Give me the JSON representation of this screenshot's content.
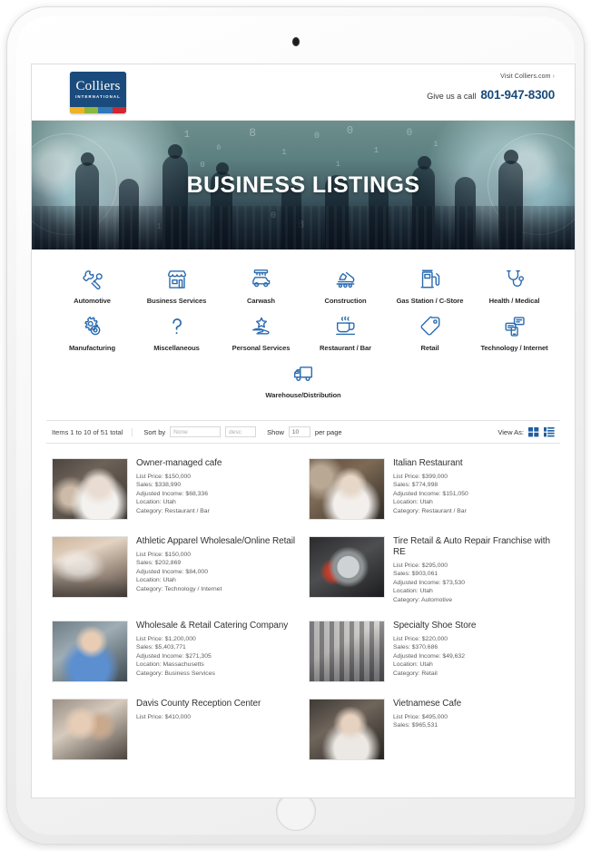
{
  "device": {
    "type": "tablet-white"
  },
  "header": {
    "logo": {
      "word": "Colliers",
      "sub": "INTERNATIONAL",
      "stripes": [
        "#f0b323",
        "#8cb63c",
        "#2e7ab8",
        "#d22630"
      ],
      "bg": "#1a4b7c"
    },
    "visit_link": "Visit Colliers.com",
    "visit_chevron": "›",
    "call_label": "Give us a call",
    "call_number": "801-947-8300",
    "accent": "#1a4b7c"
  },
  "hero": {
    "title": "BUSINESS LISTINGS"
  },
  "categories": {
    "rows": [
      [
        {
          "label": "Automotive",
          "icon": "wrench-screwdriver-icon"
        },
        {
          "label": "Business Services",
          "icon": "storefront-icon"
        },
        {
          "label": "Carwash",
          "icon": "carwash-icon"
        },
        {
          "label": "Construction",
          "icon": "excavator-icon"
        },
        {
          "label": "Gas Station / C-Store",
          "icon": "fuel-pump-icon"
        },
        {
          "label": "Health / Medical",
          "icon": "stethoscope-icon"
        }
      ],
      [
        {
          "label": "Manufacturing",
          "icon": "gears-icon"
        },
        {
          "label": "Miscellaneous",
          "icon": "question-mark-icon"
        },
        {
          "label": "Personal Services",
          "icon": "star-hand-icon"
        },
        {
          "label": "Restaurant / Bar",
          "icon": "coffee-cup-icon"
        },
        {
          "label": "Retail",
          "icon": "price-tag-icon"
        },
        {
          "label": "Technology / Internet",
          "icon": "devices-icon"
        }
      ],
      [
        {
          "label": "Warehouse/Distribution",
          "icon": "truck-icon"
        }
      ]
    ]
  },
  "toolbar": {
    "count_text": "Items 1 to 10 of 51 total",
    "sort_label": "Sort by",
    "sort_value": "None",
    "direction_value": "desc",
    "show_label": "Show",
    "show_value": "10",
    "per_page_label": "per page",
    "view_as_label": "View As:",
    "view_grid_icon": "grid-view-icon",
    "view_list_icon": "list-view-icon",
    "view_accent": "#1f5fa0"
  },
  "listings": {
    "labels": {
      "list_price": "List Price:",
      "sales": "Sales:",
      "adjusted_income": "Adjusted Income:",
      "location": "Location:",
      "category": "Category:"
    },
    "items": [
      {
        "title": "Owner-managed cafe",
        "list_price": "$150,000",
        "sales": "$338,990",
        "adjusted_income": "$68,336",
        "location": "Utah",
        "category": "Restaurant / Bar",
        "thumb": "man-in-cafe-photo"
      },
      {
        "title": "Italian Restaurant",
        "list_price": "$399,000",
        "sales": "$774,998",
        "adjusted_income": "$151,050",
        "location": "Utah",
        "category": "Restaurant / Bar",
        "thumb": "chef-in-restaurant-photo"
      },
      {
        "title": "Athletic Apparel Wholesale/Online Retail",
        "list_price": "$150,000",
        "sales": "$202,869",
        "adjusted_income": "$84,000",
        "location": "Utah",
        "category": "Technology / Internet",
        "thumb": "desk-laptop-photo"
      },
      {
        "title": "Tire Retail & Auto Repair Franchise with RE",
        "list_price": "$295,000",
        "sales": "$903,061",
        "adjusted_income": "$73,530",
        "location": "Utah",
        "category": "Automotive",
        "thumb": "brake-disc-photo"
      },
      {
        "title": "Wholesale & Retail Catering Company",
        "list_price": "$1,200,000",
        "sales": "$5,403,771",
        "adjusted_income": "$271,305",
        "location": "Massachusetts",
        "category": "Business Services",
        "thumb": "smiling-man-phone-photo"
      },
      {
        "title": "Specialty Shoe Store",
        "list_price": "$220,000",
        "sales": "$370,686",
        "adjusted_income": "$49,632",
        "location": "Utah",
        "category": "Retail",
        "thumb": "shoe-store-photo"
      },
      {
        "title": "Davis County Reception Center",
        "list_price": "$410,000",
        "sales": "",
        "adjusted_income": "",
        "location": "",
        "category": "",
        "thumb": "couple-photo"
      },
      {
        "title": "Vietnamese Cafe",
        "list_price": "$495,000",
        "sales": "$965,531",
        "adjusted_income": "",
        "location": "",
        "category": "",
        "thumb": "man-in-cafe-2-photo"
      }
    ]
  }
}
